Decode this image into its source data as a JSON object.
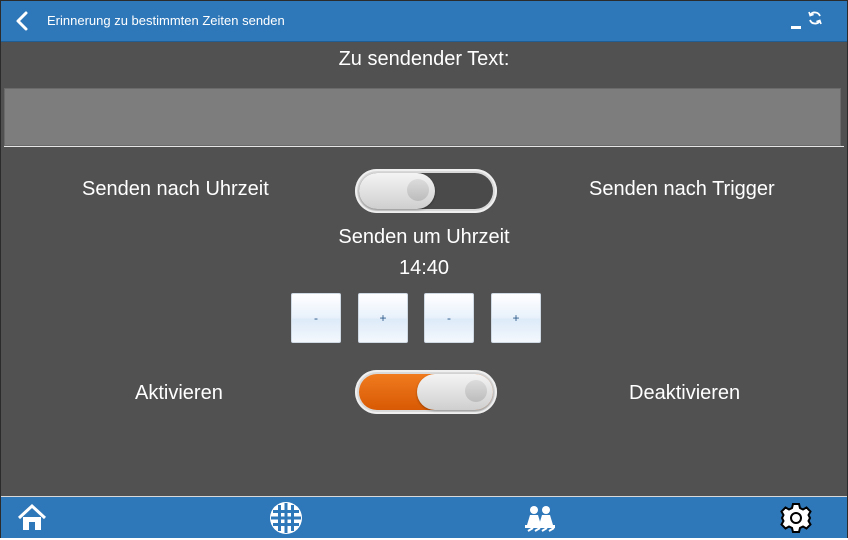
{
  "header": {
    "title": "Erinnerung zu bestimmten Zeiten senden",
    "icons": [
      "back-chevron-icon",
      "minimize-icon",
      "refresh-icon"
    ]
  },
  "text_section": {
    "label": "Zu sendender Text:",
    "value": ""
  },
  "mode": {
    "left_label": "Senden nach Uhrzeit",
    "right_label": "Senden nach Trigger",
    "toggle_state": "left"
  },
  "time": {
    "label": "Senden um Uhrzeit",
    "hours": "14",
    "separator": ":",
    "minutes": "40",
    "buttons": [
      "-",
      "+",
      "-",
      "+"
    ]
  },
  "activation": {
    "left_label": "Aktivieren",
    "right_label": "Deaktivieren",
    "toggle_state": "right",
    "active_color": "#e8650a"
  },
  "footer": {
    "icons": [
      "home-icon",
      "grid-icon",
      "people-icon",
      "gear-icon"
    ]
  },
  "colors": {
    "accent": "#2e77b8",
    "background": "#515151"
  }
}
